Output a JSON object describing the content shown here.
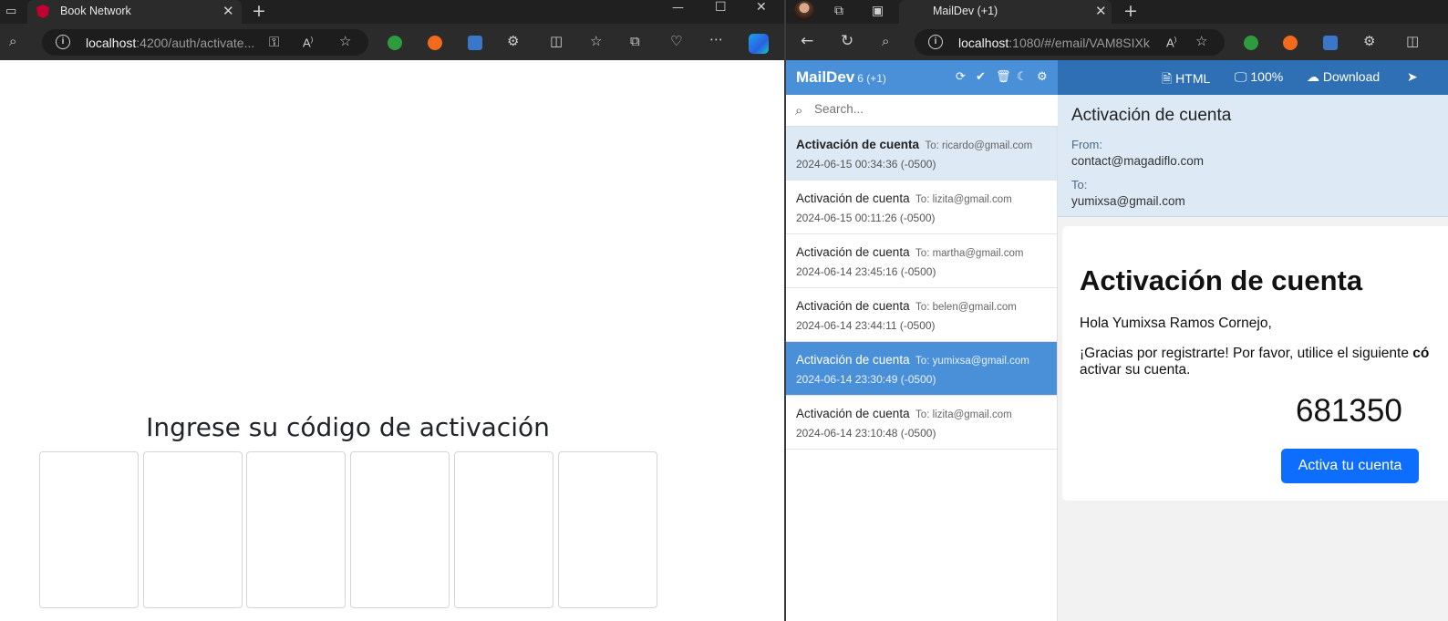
{
  "left_browser": {
    "tab_title": "Book Network",
    "url_host": "localhost",
    "url_rest": ":4200/auth/activate...",
    "window_controls": [
      "—",
      "☐",
      "✕"
    ]
  },
  "activation_page": {
    "title": "Ingrese su código de activación",
    "code_boxes": [
      "",
      "",
      "",
      "",
      "",
      ""
    ]
  },
  "right_browser": {
    "tab_title": "MailDev (+1)",
    "url_host": "localhost",
    "url_rest": ":1080/#/email/VAM8SIXk"
  },
  "maildev": {
    "title": "MailDev",
    "count": "6 (+1)",
    "search_placeholder": "Search...",
    "emails": [
      {
        "subject": "Activación de cuenta",
        "to": "To: ricardo@gmail.com",
        "date": "2024-06-15 00:34:36 (-0500)"
      },
      {
        "subject": "Activación de cuenta",
        "to": "To: lizita@gmail.com",
        "date": "2024-06-15 00:11:26 (-0500)"
      },
      {
        "subject": "Activación de cuenta",
        "to": "To: martha@gmail.com",
        "date": "2024-06-14 23:45:16 (-0500)"
      },
      {
        "subject": "Activación de cuenta",
        "to": "To: belen@gmail.com",
        "date": "2024-06-14 23:44:11 (-0500)"
      },
      {
        "subject": "Activación de cuenta",
        "to": "To: yumixsa@gmail.com",
        "date": "2024-06-14 23:30:49 (-0500)"
      },
      {
        "subject": "Activación de cuenta",
        "to": "To: lizita@gmail.com",
        "date": "2024-06-14 23:10:48 (-0500)"
      }
    ],
    "toolbar": {
      "html_label": "HTML",
      "zoom_label": "100%",
      "download_label": "Download"
    },
    "message": {
      "subject": "Activación de cuenta",
      "from_label": "From:",
      "from": "contact@magadiflo.com",
      "to_label": "To:",
      "to": "yumixsa@gmail.com",
      "heading": "Activación de cuenta",
      "greeting": "Hola Yumixsa Ramos Cornejo,",
      "paragraph_start": "¡Gracias por registrarte! Por favor, utilice el siguiente ",
      "paragraph_bold": "có",
      "paragraph_end": "activar su cuenta.",
      "code": "681350",
      "button_label": "Activa tu cuenta"
    }
  },
  "colors": {
    "maildev_blue": "#4a90d9",
    "maildev_dark_blue": "#2f6fb3",
    "button_blue": "#0d6efd",
    "chrome_dark": "#202020"
  }
}
